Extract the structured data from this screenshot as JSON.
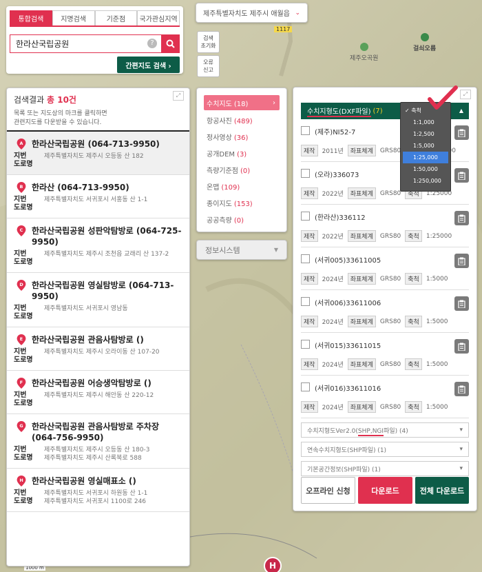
{
  "map": {
    "road_number": "1117",
    "place_labels": [
      "제주오곡원",
      "걸쇠오름"
    ]
  },
  "search": {
    "tabs": [
      "통합검색",
      "지명검색",
      "기준점",
      "국가관심지역"
    ],
    "query": "한라산국립공원",
    "help": "?",
    "easy_map_button": "간편지도 검색 ›"
  },
  "region_select": "제주특별자치도 제주시 애월읍",
  "side_buttons": {
    "reset": "검색\n초기화",
    "report": "오류\n신고"
  },
  "results": {
    "title_prefix": "검색결과",
    "count": "총 10건",
    "desc": "목록 또는 지도상의 마크를 클릭하면\n관련지도를 다운받을 수 있습니다.",
    "items": [
      {
        "marker": "A",
        "name": "한라산국립공원 (064-713-9950)",
        "jibun": "제주특별자치도 제주시 오등동 산 182",
        "road": ""
      },
      {
        "marker": "B",
        "name": "한라산 (064-713-9950)",
        "jibun": "제주특별자치도 서귀포시 서홍동 산 1-1",
        "road": ""
      },
      {
        "marker": "C",
        "name": "한라산국립공원 성판악탐방로 (064-725-9950)",
        "jibun": "제주특별자치도 제주시 조천읍 교래리 산 137-2",
        "road": ""
      },
      {
        "marker": "D",
        "name": "한라산국립공원 영실탐방로 (064-713-9950)",
        "jibun": "제주특별자치도 서귀포시 영남동",
        "road": ""
      },
      {
        "marker": "E",
        "name": "한라산국립공원 관음사탐방로 ()",
        "jibun": "제주특별자치도 제주시 오라이동 산 107-20",
        "road": ""
      },
      {
        "marker": "F",
        "name": "한라산국립공원 어승생악탐방로 ()",
        "jibun": "제주특별자치도 제주시 해안동 산 220-12",
        "road": ""
      },
      {
        "marker": "G",
        "name": "한라산국립공원 관음사탐방로 주차장 (064-756-9950)",
        "jibun": "제주특별자치도 제주시 오등동 산 180-3",
        "road": "제주특별자치도 제주시 산록북로 588"
      },
      {
        "marker": "H",
        "name": "한라산국립공원 영실매표소 ()",
        "jibun": "제주특별자치도 서귀포시 하원동 산 1-1",
        "road": "제주특별자치도 서귀포시 1100로 246"
      }
    ],
    "label_jibun": "지번",
    "label_road": "도로명"
  },
  "categories": [
    {
      "name": "수치지도",
      "count": "(18)",
      "active": true
    },
    {
      "name": "항공사진",
      "count": "(489)"
    },
    {
      "name": "정사영상",
      "count": "(36)"
    },
    {
      "name": "공개DEM",
      "count": "(3)"
    },
    {
      "name": "측량기준점",
      "count": "(0)"
    },
    {
      "name": "온맵",
      "count": "(109)"
    },
    {
      "name": "종이지도",
      "count": "(153)"
    },
    {
      "name": "공공측량",
      "count": "(0)"
    }
  ],
  "info_system": "정보시스템",
  "dxf": {
    "header_label": "수치지형도(DXF파일)",
    "header_count": "(7)",
    "tag_labels": {
      "made": "제작",
      "coord": "좌표체계",
      "scale": "축척"
    },
    "items": [
      {
        "title": "(제주)NI52-7",
        "year": "2011년",
        "crs": "GRS80",
        "scale": "1:250000"
      },
      {
        "title": "(오라)336073",
        "year": "2022년",
        "crs": "GRS80",
        "scale": "1:25000"
      },
      {
        "title": "(한라산)336112",
        "year": "2022년",
        "crs": "GRS80",
        "scale": "1:25000"
      },
      {
        "title": "(서귀005)33611005",
        "year": "2024년",
        "crs": "GRS80",
        "scale": "1:5000"
      },
      {
        "title": "(서귀006)33611006",
        "year": "2024년",
        "crs": "GRS80",
        "scale": "1:5000"
      },
      {
        "title": "(서귀015)33611015",
        "year": "2024년",
        "crs": "GRS80",
        "scale": "1:5000"
      },
      {
        "title": "(서귀016)33611016",
        "year": "2024년",
        "crs": "GRS80",
        "scale": "1:5000"
      }
    ],
    "sub_selects": [
      {
        "prefix": "수치지형도Ver2.0(",
        "highlight": "SHP,NGI",
        "suffix": "파일) (4)"
      },
      {
        "prefix": "연속수치지형도(SHP파일) (1)",
        "highlight": "",
        "suffix": ""
      },
      {
        "prefix": "기본공간정보(SHP파일) (1)",
        "highlight": "",
        "suffix": ""
      }
    ],
    "buttons": {
      "offline": "오프라인 신청",
      "download": "다운로드",
      "all": "전체 다운로드"
    }
  },
  "scale_dropdown": {
    "options": [
      "✓ 축척",
      "1:1,000",
      "1:2,500",
      "1:5,000",
      "1:25,000",
      "1:50,000",
      "1:250,000"
    ],
    "selected_index": 4
  },
  "scale_bar_text": "1000 m",
  "colors": {
    "accent": "#e0304f",
    "green": "#0d5c47"
  }
}
